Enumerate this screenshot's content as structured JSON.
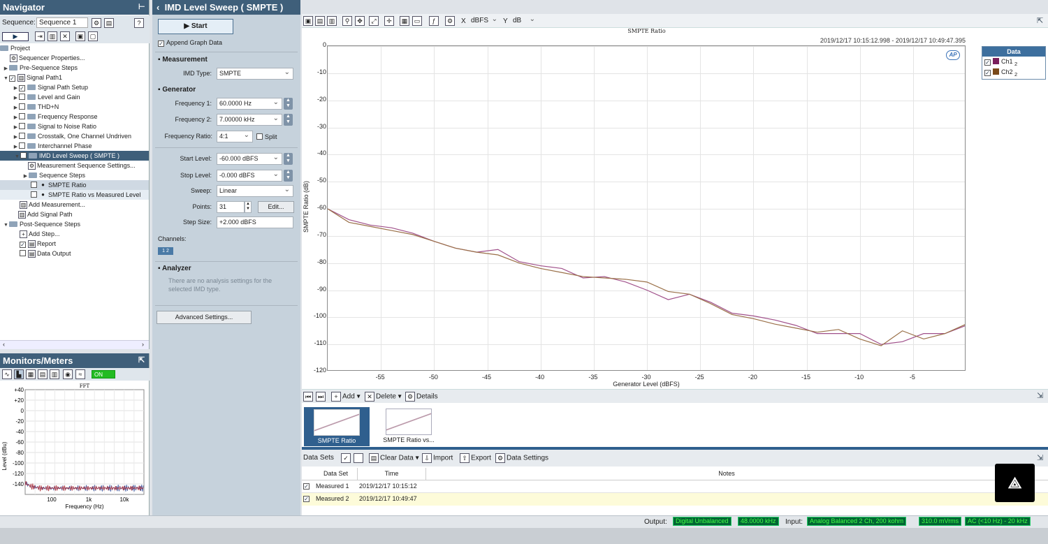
{
  "navigator": {
    "title": "Navigator",
    "sequence_label": "Sequence:",
    "sequence_value": "Sequence 1",
    "tree": [
      {
        "label": "Project",
        "check": "",
        "tri": "",
        "icon": "folder"
      },
      {
        "label": "Sequencer Properties...",
        "check": "",
        "tri": "",
        "icon": "gear"
      },
      {
        "label": "Pre-Sequence Steps",
        "check": "",
        "tri": "▶",
        "icon": "folder"
      },
      {
        "label": "Signal Path1",
        "check": "✓",
        "tri": "▼",
        "icon": "step"
      },
      {
        "label": "Signal Path Setup",
        "check": "✓",
        "tri": "▶",
        "icon": "folder"
      },
      {
        "label": "Level and Gain",
        "check": "",
        "tri": "▶",
        "icon": "folder"
      },
      {
        "label": "THD+N",
        "check": "",
        "tri": "▶",
        "icon": "folder"
      },
      {
        "label": "Frequency Response",
        "check": "",
        "tri": "▶",
        "icon": "folder"
      },
      {
        "label": "Signal to Noise Ratio",
        "check": "",
        "tri": "▶",
        "icon": "folder"
      },
      {
        "label": "Crosstalk, One Channel Undriven",
        "check": "",
        "tri": "▶",
        "icon": "folder"
      },
      {
        "label": "Interchannel Phase",
        "check": "",
        "tri": "▶",
        "icon": "folder"
      },
      {
        "label": "IMD Level Sweep ( SMPTE )",
        "check": "",
        "tri": "▼",
        "icon": "folder"
      },
      {
        "label": "Measurement Sequence Settings...",
        "check": "",
        "tri": "",
        "icon": "gear"
      },
      {
        "label": "Sequence Steps",
        "check": "",
        "tri": "▶",
        "icon": "folder"
      },
      {
        "label": "SMPTE Ratio",
        "check": "",
        "tri": "",
        "icon": "dot"
      },
      {
        "label": "SMPTE Ratio vs Measured Level",
        "check": "",
        "tri": "",
        "icon": "dot"
      },
      {
        "label": "Add Measurement...",
        "check": "",
        "tri": "",
        "icon": "chart"
      },
      {
        "label": "Add Signal Path",
        "check": "",
        "tri": "",
        "icon": "chart"
      },
      {
        "label": "Post-Sequence Steps",
        "check": "",
        "tri": "▼",
        "icon": "folder"
      },
      {
        "label": "Add Step...",
        "check": "",
        "tri": "",
        "icon": "plus"
      },
      {
        "label": "Report",
        "check": "✓",
        "tri": "",
        "icon": "doc"
      },
      {
        "label": "Data Output",
        "check": "",
        "tri": "",
        "icon": "doc"
      }
    ]
  },
  "monitors": {
    "title": "Monitors/Meters",
    "on_label": "ON",
    "fft_title": "FFT",
    "ylabel": "Level (dBu)",
    "xlabel": "Frequency (Hz)",
    "yticks": [
      "+40",
      "+20",
      "0",
      "-20",
      "-40",
      "-60",
      "-80",
      "-100",
      "-120",
      "-140"
    ],
    "xticks": [
      "100",
      "1k",
      "10k"
    ]
  },
  "panel": {
    "title": "IMD Level Sweep ( SMPTE )",
    "start_label": "Start",
    "append_label": "Append Graph Data",
    "measurement_label": "Measurement",
    "imd_type_label": "IMD Type:",
    "imd_type_value": "SMPTE",
    "generator_label": "Generator",
    "freq1_label": "Frequency 1:",
    "freq1_value": "60.0000 Hz",
    "freq2_label": "Frequency 2:",
    "freq2_value": "7.00000 kHz",
    "ratio_label": "Frequency Ratio:",
    "ratio_value": "4:1",
    "split_label": "Split",
    "start_level_label": "Start Level:",
    "start_level_value": "-60.000 dBFS",
    "stop_level_label": "Stop Level:",
    "stop_level_value": "-0.000 dBFS",
    "sweep_label": "Sweep:",
    "sweep_value": "Linear",
    "points_label": "Points:",
    "points_value": "31",
    "edit_label": "Edit...",
    "step_size_label": "Step Size:",
    "step_size_value": "+2.000 dBFS",
    "channels_label": "Channels:",
    "analyzer_label": "Analyzer",
    "analyzer_note": "There are no analysis settings for the selected IMD type.",
    "advanced_label": "Advanced Settings..."
  },
  "graph_toolbar": {
    "x_label": "X",
    "x_unit": "dBFS",
    "y_label": "Y",
    "y_unit": "dB"
  },
  "chart_data": {
    "type": "line",
    "title": "SMPTE Ratio",
    "timestamp": "2019/12/17 10:15:12.998 - 2019/12/17 10:49:47.395",
    "xlabel": "Generator Level (dBFS)",
    "ylabel": "SMPTE Ratio (dB)",
    "xlim": [
      -60,
      0
    ],
    "ylim": [
      -120,
      0
    ],
    "xticks": [
      -55,
      -50,
      -45,
      -40,
      -35,
      -30,
      -25,
      -20,
      -15,
      -10,
      -5
    ],
    "yticks": [
      0,
      -10,
      -20,
      -30,
      -40,
      -50,
      -60,
      -70,
      -80,
      -90,
      -100,
      -110,
      -120
    ],
    "grid": true,
    "x": [
      -60,
      -58,
      -56,
      -54,
      -52,
      -50,
      -48,
      -46,
      -44,
      -42,
      -40,
      -38,
      -36,
      -34,
      -32,
      -30,
      -28,
      -26,
      -24,
      -22,
      -20,
      -18,
      -16,
      -14,
      -12,
      -10,
      -8,
      -6,
      -4,
      -2,
      0
    ],
    "series": [
      {
        "name": "Ch1",
        "color": "#a0508a",
        "values": [
          -60,
          -64,
          -66,
          -67,
          -69,
          -72,
          -74.5,
          -76,
          -75,
          -79.5,
          -81,
          -82,
          -85.5,
          -85,
          -87,
          -90,
          -93.5,
          -91.5,
          -94.5,
          -98.5,
          -99.5,
          -101,
          -103,
          -106,
          -106,
          -106,
          -110,
          -109,
          -106,
          -106,
          -103
        ]
      },
      {
        "name": "Ch2",
        "color": "#9a7048",
        "values": [
          -60,
          -65,
          -66.5,
          -68,
          -69.5,
          -72,
          -74.5,
          -76,
          -77,
          -80,
          -82,
          -83.5,
          -85,
          -85.5,
          -86,
          -87,
          -90.5,
          -91.5,
          -95,
          -99,
          -100.5,
          -102.5,
          -104,
          -105.5,
          -104.5,
          -108,
          -110.5,
          -105,
          -108,
          -106,
          -102.5
        ]
      }
    ]
  },
  "legend": {
    "title": "Data",
    "items": [
      {
        "label": "Ch1",
        "sub": "2",
        "color": "#7a1f5c"
      },
      {
        "label": "Ch2",
        "sub": "2",
        "color": "#7a4a1a"
      }
    ]
  },
  "graph_actions": {
    "add": "Add",
    "delete": "Delete",
    "details": "Details"
  },
  "thumbs": [
    {
      "label": "SMPTE Ratio"
    },
    {
      "label": "SMPTE Ratio vs..."
    }
  ],
  "datasets": {
    "title": "Data Sets",
    "clear": "Clear Data",
    "import": "Import",
    "export": "Export",
    "settings": "Data Settings",
    "columns": [
      "Data Set",
      "Time",
      "Notes"
    ],
    "rows": [
      {
        "name": "Measured 1",
        "time": "2019/12/17 10:15:12"
      },
      {
        "name": "Measured 2",
        "time": "2019/12/17 10:49:47"
      }
    ]
  },
  "status": {
    "output_label": "Output:",
    "output_value": "Digital Unbalanced",
    "output_rate": "48.0000 kHz",
    "input_label": "Input:",
    "input_value": "Analog Balanced 2 Ch, 200 kohm",
    "input_level": "310.0 mVrms",
    "input_coupling": "AC (<10 Hz) - 20 kHz"
  }
}
